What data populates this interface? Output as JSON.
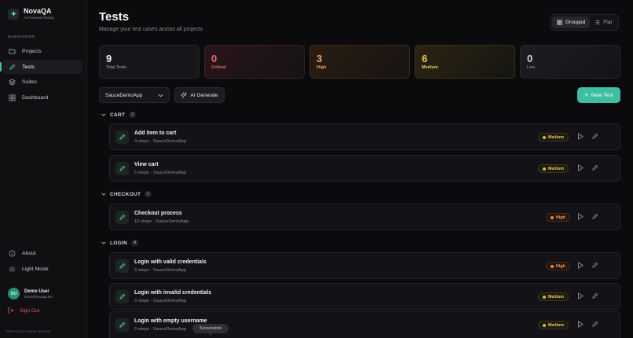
{
  "brand": {
    "name": "NovaQA",
    "tagline": "AI-Powered Testing"
  },
  "sidebar": {
    "heading": "NAVIGATION",
    "items": [
      {
        "label": "Projects",
        "icon": "folder-icon",
        "active": false
      },
      {
        "label": "Tests",
        "icon": "pencil-icon",
        "active": true
      },
      {
        "label": "Suites",
        "icon": "layers-icon",
        "active": false
      },
      {
        "label": "Dashboard",
        "icon": "grid-icon",
        "active": false
      }
    ],
    "bottom": [
      {
        "label": "About",
        "icon": "info-icon"
      },
      {
        "label": "Light Mode",
        "icon": "sun-icon"
      }
    ],
    "user": {
      "initials": "DU",
      "name": "Demo User",
      "email": "demo@novaqa.dev"
    },
    "signout": "Sign Out",
    "footer": "Powered by Amazon Nova Act"
  },
  "header": {
    "title": "Tests",
    "subtitle": "Manage your test cases across all projects"
  },
  "view_toggle": {
    "grouped": "Grouped",
    "flat": "Flat",
    "selected": "Grouped"
  },
  "stats": [
    {
      "value": "9",
      "label": "Total Tests"
    },
    {
      "value": "0",
      "label": "Critical"
    },
    {
      "value": "3",
      "label": "High"
    },
    {
      "value": "6",
      "label": "Medium"
    },
    {
      "value": "0",
      "label": "Low"
    }
  ],
  "toolbar": {
    "project_select": "SauceDemoApp",
    "ai_generate": "AI Generate",
    "new_test": "New Test"
  },
  "groups": [
    {
      "name": "CART",
      "count": "2",
      "tests": [
        {
          "name": "Add item to cart",
          "steps": "4 steps",
          "project": "SauceDemoApp",
          "priority": "Medium"
        },
        {
          "name": "View cart",
          "steps": "5 steps",
          "project": "SauceDemoApp",
          "priority": "Medium"
        }
      ]
    },
    {
      "name": "CHECKOUT",
      "count": "1",
      "tests": [
        {
          "name": "Checkout process",
          "steps": "10 steps",
          "project": "SauceDemoApp",
          "priority": "High"
        }
      ]
    },
    {
      "name": "LOGIN",
      "count": "4",
      "tests": [
        {
          "name": "Login with valid credentials",
          "steps": "3 steps",
          "project": "SauceDemoApp",
          "priority": "High"
        },
        {
          "name": "Login with invalid credentials",
          "steps": "3 steps",
          "project": "SauceDemoApp",
          "priority": "Medium"
        },
        {
          "name": "Login with empty username",
          "steps": "3 steps",
          "project": "SauceDemoApp",
          "priority": "Medium"
        }
      ]
    }
  ],
  "separator": "·",
  "tooltip": "Screenshot",
  "colors": {
    "accent": "#3fbfa1",
    "critical": "#e46a6a",
    "high": "#ee8a3a",
    "medium": "#e1b83a",
    "low": "#9a9aa2"
  }
}
